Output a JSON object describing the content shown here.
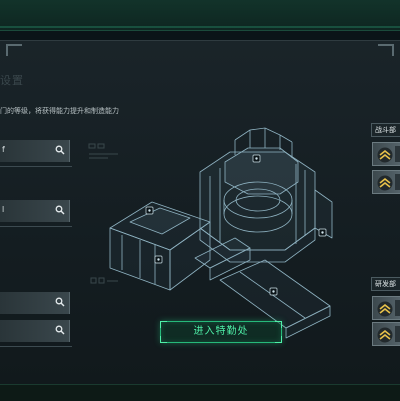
{
  "watermark": "设置",
  "description": "门的等级，将获得能力提升和制造能力",
  "left_slots": [
    {
      "label": "f"
    },
    {
      "label": "l"
    },
    {
      "label": ""
    },
    {
      "label": ""
    }
  ],
  "enter_button": {
    "label": "进入特勤处"
  },
  "right_panel": {
    "groups": [
      {
        "label": "战斗部"
      },
      {
        "label": "研发部"
      }
    ]
  },
  "colors": {
    "accent_green": "#4ff0a8",
    "wireframe": "#8fb3c2",
    "panel_bg": "#1a2429"
  }
}
